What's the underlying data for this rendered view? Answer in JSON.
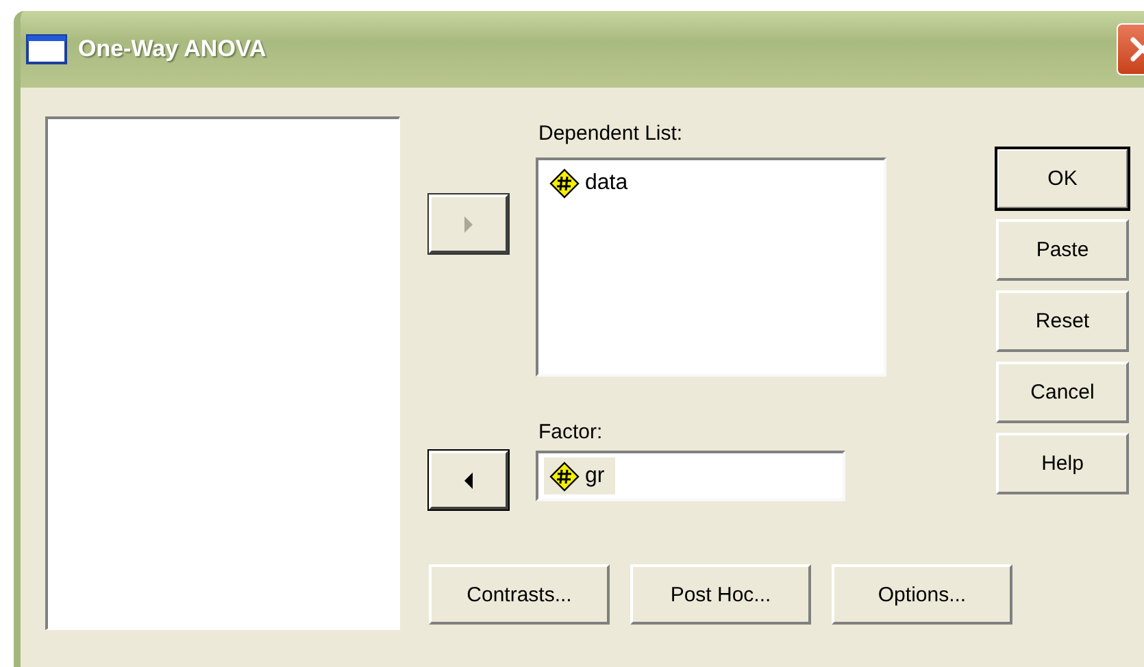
{
  "window": {
    "title": "One-Way ANOVA"
  },
  "move_buttons": [
    {
      "kind": "right",
      "disabled": true
    },
    {
      "kind": "left",
      "disabled": false
    }
  ],
  "dependent_list": {
    "label": "Dependent List:",
    "items": [
      {
        "name": "data"
      }
    ]
  },
  "factor": {
    "label": "Factor:",
    "value": "gr"
  },
  "action_buttons": [
    {
      "label": "OK",
      "default": true
    },
    {
      "label": "Paste",
      "default": false
    },
    {
      "label": "Reset",
      "default": false
    },
    {
      "label": "Cancel",
      "default": false
    },
    {
      "label": "Help",
      "default": false
    }
  ],
  "bottom_buttons": [
    {
      "label": "Contrasts..."
    },
    {
      "label": "Post Hoc..."
    },
    {
      "label": "Options..."
    }
  ]
}
